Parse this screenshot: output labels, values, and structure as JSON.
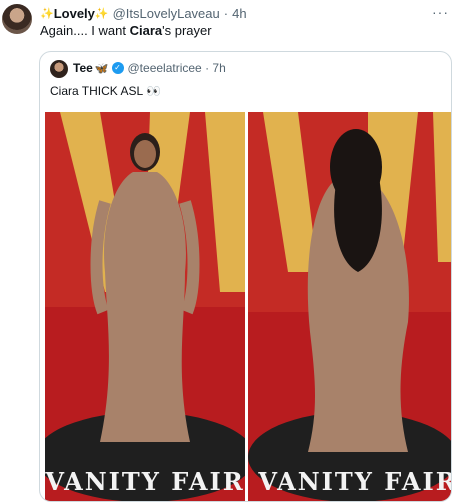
{
  "tweet": {
    "avatar_icon": "user-avatar",
    "spark_left": "✨",
    "name": "Lovely",
    "spark_right": "✨",
    "handle": "@ItsLovelyLaveau",
    "time": "4h",
    "more_icon": "more-icon",
    "text_before": "Again.... I want ",
    "text_bold": "Ciara",
    "text_after": "'s prayer"
  },
  "quote": {
    "avatar_icon": "user-avatar",
    "name": "Tee",
    "emoji": "🦋",
    "verified_icon": "verified-badge-icon",
    "handle": "@teeelatricee",
    "time": "7h",
    "text": "Ciara THICK ASL 👀",
    "photos": [
      "front-view-photo",
      "back-view-photo"
    ],
    "photo_backdrop_text": "VANITY FAIR"
  },
  "colors": {
    "backdrop_gold": "#e1b24e",
    "backdrop_red": "#c42b25",
    "carpet": "#b81c1f",
    "dress": "#a8826a",
    "handle": "#536471",
    "border": "#cfd9de"
  }
}
